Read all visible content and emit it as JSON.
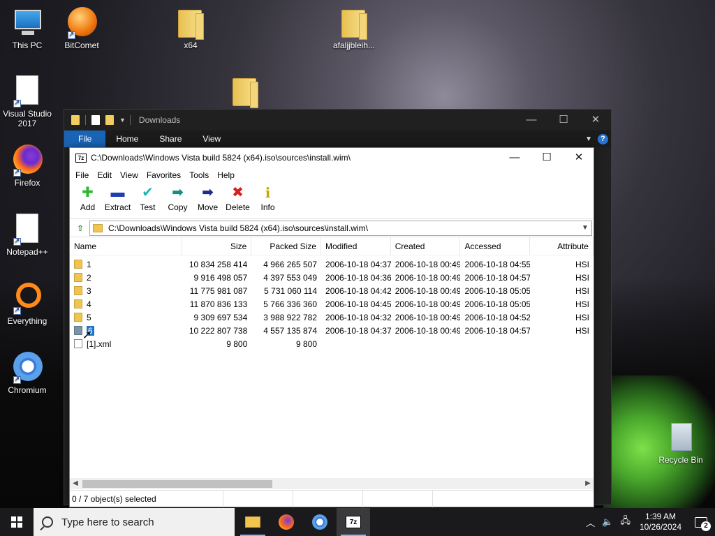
{
  "desktop": {
    "icons": [
      {
        "label": "This PC"
      },
      {
        "label": "BitComet"
      },
      {
        "label": "x64"
      },
      {
        "label": "afaljjbleih..."
      },
      {
        "label": "Visual Studio 2017"
      },
      {
        "label": "Firefox"
      },
      {
        "label": "Notepad++"
      },
      {
        "label": "Everything"
      },
      {
        "label": "Chromium"
      },
      {
        "label": "Recycle Bin"
      }
    ]
  },
  "explorer": {
    "title": "Downloads",
    "ribbon_tabs": [
      "File",
      "Home",
      "Share",
      "View"
    ],
    "help_glyph": "?"
  },
  "sevenzip": {
    "title": "C:\\Downloads\\Windows Vista build 5824 (x64).iso\\sources\\install.wim\\",
    "logo_text": "7z",
    "menu": [
      "File",
      "Edit",
      "View",
      "Favorites",
      "Tools",
      "Help"
    ],
    "toolbar": [
      {
        "label": "Add",
        "icon": "plus-icon",
        "glyph": "✚",
        "color": "#2fb82f"
      },
      {
        "label": "Extract",
        "icon": "minus-icon",
        "glyph": "▬",
        "color": "#1f3fb0"
      },
      {
        "label": "Test",
        "icon": "check-icon",
        "glyph": "✔",
        "color": "#1fb3b8"
      },
      {
        "label": "Copy",
        "icon": "arrow-right-icon",
        "glyph": "➡",
        "color": "#1d8a86"
      },
      {
        "label": "Move",
        "icon": "arrow-right-icon",
        "glyph": "➡",
        "color": "#1b2d8c"
      },
      {
        "label": "Delete",
        "icon": "x-icon",
        "glyph": "✖",
        "color": "#d61f1f"
      },
      {
        "label": "Info",
        "icon": "info-icon",
        "glyph": "i",
        "color": "#c9a400"
      }
    ],
    "address": "C:\\Downloads\\Windows Vista build 5824 (x64).iso\\sources\\install.wim\\",
    "columns": [
      "Name",
      "Size",
      "Packed Size",
      "Modified",
      "Created",
      "Accessed",
      "Attribute"
    ],
    "rows": [
      {
        "name": "1",
        "size": "10 834 258 414",
        "packed": "4 966 265 507",
        "modified": "2006-10-18 04:37",
        "created": "2006-10-18 00:49",
        "accessed": "2006-10-18 04:55",
        "attr": "HSI",
        "type": "folder"
      },
      {
        "name": "2",
        "size": "9 916 498 057",
        "packed": "4 397 553 049",
        "modified": "2006-10-18 04:36",
        "created": "2006-10-18 00:49",
        "accessed": "2006-10-18 04:57",
        "attr": "HSI",
        "type": "folder"
      },
      {
        "name": "3",
        "size": "11 775 981 087",
        "packed": "5 731 060 114",
        "modified": "2006-10-18 04:42",
        "created": "2006-10-18 00:49",
        "accessed": "2006-10-18 05:05",
        "attr": "HSI",
        "type": "folder"
      },
      {
        "name": "4",
        "size": "11 870 836 133",
        "packed": "5 766 336 360",
        "modified": "2006-10-18 04:45",
        "created": "2006-10-18 00:49",
        "accessed": "2006-10-18 05:05",
        "attr": "HSI",
        "type": "folder"
      },
      {
        "name": "5",
        "size": "9 309 697 534",
        "packed": "3 988 922 782",
        "modified": "2006-10-18 04:32",
        "created": "2006-10-18 00:49",
        "accessed": "2006-10-18 04:52",
        "attr": "HSI",
        "type": "folder"
      },
      {
        "name": "6",
        "size": "10 222 807 738",
        "packed": "4 557 135 874",
        "modified": "2006-10-18 04:37",
        "created": "2006-10-18 00:49",
        "accessed": "2006-10-18 04:57",
        "attr": "HSI",
        "type": "folder-selected"
      },
      {
        "name": "[1].xml",
        "size": "9 800",
        "packed": "9 800",
        "modified": "",
        "created": "",
        "accessed": "",
        "attr": "",
        "type": "xml"
      }
    ],
    "status": "0 / 7 object(s) selected"
  },
  "taskbar": {
    "search_placeholder": "Type here to search",
    "time": "1:39 AM",
    "date": "10/26/2024",
    "notification_count": "2"
  }
}
